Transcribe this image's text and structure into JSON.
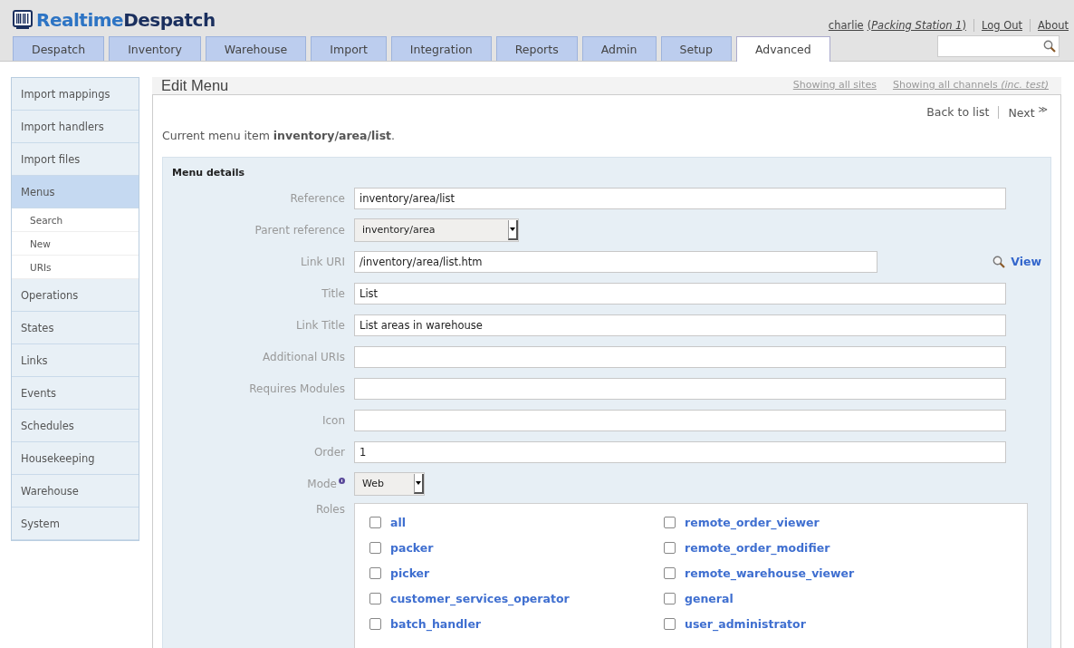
{
  "logo": {
    "part_1": "Realtime",
    "part_2": "Despatch"
  },
  "user_links": {
    "user": "charlie",
    "station": "(*Packing Station 1*)",
    "logout": "Log Out",
    "about": "About"
  },
  "tabs": [
    {
      "label": "Despatch",
      "selected": false
    },
    {
      "label": "Inventory",
      "selected": false
    },
    {
      "label": "Warehouse",
      "selected": false
    },
    {
      "label": "Import",
      "selected": false
    },
    {
      "label": "Integration",
      "selected": false
    },
    {
      "label": "Reports",
      "selected": false
    },
    {
      "label": "Admin",
      "selected": false
    },
    {
      "label": "Setup",
      "selected": false
    },
    {
      "label": "Advanced",
      "selected": true
    }
  ],
  "sidebar": {
    "items": [
      {
        "label": "Import mappings",
        "selected": false
      },
      {
        "label": "Import handlers",
        "selected": false
      },
      {
        "label": "Import files",
        "selected": false
      },
      {
        "label": "Menus",
        "selected": true,
        "children": [
          {
            "label": "Search"
          },
          {
            "label": "New"
          },
          {
            "label": "URIs"
          }
        ]
      },
      {
        "label": "Operations",
        "selected": false
      },
      {
        "label": "States",
        "selected": false
      },
      {
        "label": "Links",
        "selected": false
      },
      {
        "label": "Events",
        "selected": false
      },
      {
        "label": "Schedules",
        "selected": false
      },
      {
        "label": "Housekeeping",
        "selected": false
      },
      {
        "label": "Warehouse",
        "selected": false
      },
      {
        "label": "System",
        "selected": false
      }
    ]
  },
  "panel": {
    "title": "Edit Menu",
    "filters": [
      "Showing all sites",
      "Showing all channels *(inc. test)*"
    ],
    "back_link": "Back to list",
    "next_link": "Next",
    "next_symbol": "≫",
    "current_item": "Current menu item **inventory/area/list**.",
    "section_title": "Menu details",
    "fields": [
      {
        "kind": "text",
        "label": "Reference",
        "value": "inventory/area/list"
      },
      {
        "kind": "select",
        "label": "Parent reference",
        "value": "inventory/area"
      },
      {
        "kind": "link",
        "label": "Link URI",
        "value": "/inventory/area/list.htm",
        "action": "View"
      },
      {
        "kind": "text",
        "label": "Title",
        "value": "List"
      },
      {
        "kind": "text",
        "label": "Link Title",
        "value": "List areas in warehouse"
      },
      {
        "kind": "text",
        "label": "Additional URIs"
      },
      {
        "kind": "text",
        "label": "Requires Modules"
      },
      {
        "kind": "text",
        "label": "Icon"
      },
      {
        "kind": "text",
        "label": "Order",
        "value": "1"
      },
      {
        "kind": "mode",
        "label": "Mode",
        "value": "Web"
      }
    ],
    "roles_label": "Roles",
    "roles": [
      {
        "label": "all",
        "checked": false
      },
      {
        "label": "remote_order_viewer",
        "checked": false
      },
      {
        "label": "packer",
        "checked": false
      },
      {
        "label": "remote_order_modifier",
        "checked": false
      },
      {
        "label": "picker",
        "checked": false
      },
      {
        "label": "remote_warehouse_viewer",
        "checked": false
      },
      {
        "label": "customer_services_operator",
        "checked": false
      },
      {
        "label": "general",
        "checked": false
      },
      {
        "label": "batch_handler",
        "checked": false
      },
      {
        "label": "user_administrator",
        "checked": false
      }
    ]
  }
}
